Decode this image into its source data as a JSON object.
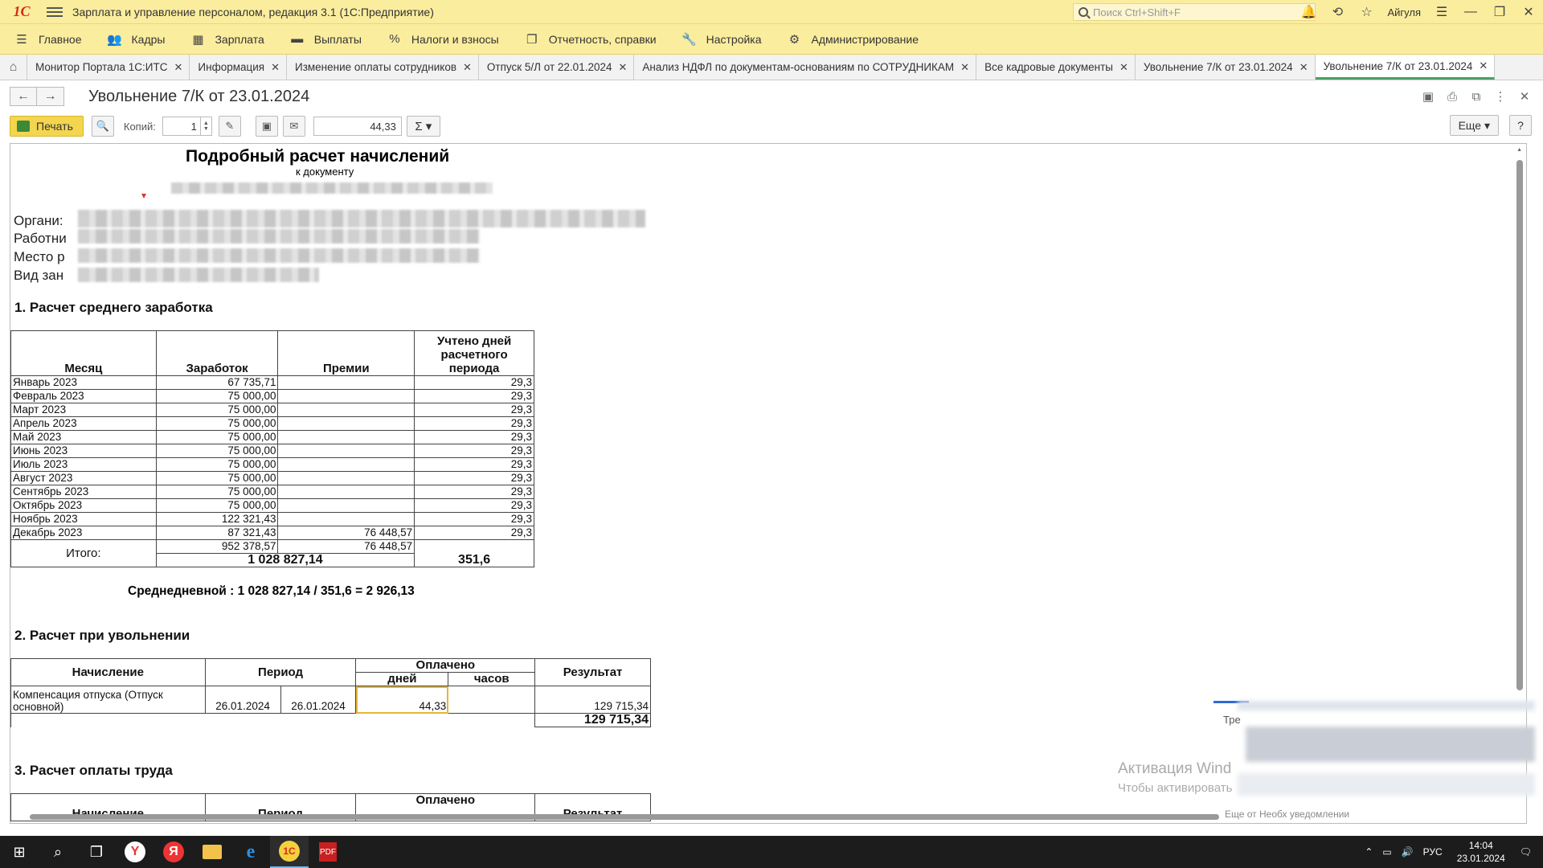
{
  "titlebar": {
    "logo": "1С",
    "title": "Зарплата и управление персоналом, редакция 3.1  (1С:Предприятие)",
    "search_placeholder": "Поиск Ctrl+Shift+F",
    "user": "Айгуля"
  },
  "menu": [
    {
      "label": "Главное",
      "icon": "menu-icon"
    },
    {
      "label": "Кадры",
      "icon": "people-icon"
    },
    {
      "label": "Зарплата",
      "icon": "calculator-icon"
    },
    {
      "label": "Выплаты",
      "icon": "wallet-icon"
    },
    {
      "label": "Налоги и взносы",
      "icon": "percent-icon"
    },
    {
      "label": "Отчетность, справки",
      "icon": "report-icon"
    },
    {
      "label": "Настройка",
      "icon": "wrench-icon"
    },
    {
      "label": "Администрирование",
      "icon": "gear-icon"
    }
  ],
  "tabs": [
    "Монитор Портала 1С:ИТС",
    "Информация",
    "Изменение оплаты сотрудников",
    "Отпуск 5/Л от 22.01.2024",
    "Анализ НДФЛ по документам-основаниям по СОТРУДНИКАМ",
    "Все кадровые документы",
    "Увольнение 7/К от 23.01.2024",
    "Увольнение 7/К от 23.01.2024"
  ],
  "doc": {
    "title": "Увольнение 7/К от 23.01.2024"
  },
  "toolbar": {
    "print_label": "Печать",
    "copies_label": "Копий:",
    "copies_value": "1",
    "sum_value": "44,33",
    "more_label": "Еще",
    "help_label": "?"
  },
  "report": {
    "title": "Подробный расчет начислений",
    "subtitle": "к документу",
    "info_labels": [
      "Органи:",
      "Работни",
      "Место р",
      "Вид зан"
    ],
    "section1": "1. Расчет среднего заработка",
    "t1_headers": [
      "Месяц",
      "Заработок",
      "Премии",
      "Учтено дней расчетного периода"
    ],
    "t1_rows": [
      [
        "Январь 2023",
        "67 735,71",
        "",
        "29,3"
      ],
      [
        "Февраль 2023",
        "75 000,00",
        "",
        "29,3"
      ],
      [
        "Март 2023",
        "75 000,00",
        "",
        "29,3"
      ],
      [
        "Апрель 2023",
        "75 000,00",
        "",
        "29,3"
      ],
      [
        "Май 2023",
        "75 000,00",
        "",
        "29,3"
      ],
      [
        "Июнь 2023",
        "75 000,00",
        "",
        "29,3"
      ],
      [
        "Июль 2023",
        "75 000,00",
        "",
        "29,3"
      ],
      [
        "Август 2023",
        "75 000,00",
        "",
        "29,3"
      ],
      [
        "Сентябрь 2023",
        "75 000,00",
        "",
        "29,3"
      ],
      [
        "Октябрь 2023",
        "75 000,00",
        "",
        "29,3"
      ],
      [
        "Ноябрь 2023",
        "122 321,43",
        "",
        "29,3"
      ],
      [
        "Декабрь 2023",
        "87 321,43",
        "76 448,57",
        "29,3"
      ]
    ],
    "t1_subtotal": [
      "952 378,57",
      "76 448,57"
    ],
    "t1_total_label": "Итого:",
    "t1_total": "1 028 827,14",
    "t1_total_days": "351,6",
    "avg_text": "Среднедневной : 1 028 827,14 / 351,6 =   2 926,13",
    "section2": "2. Расчет при увольнении",
    "t2_headers": {
      "accrual": "Начисление",
      "period": "Период",
      "paid": "Оплачено",
      "days": "дней",
      "hours": "часов",
      "result": "Результат"
    },
    "t2_row": {
      "accrual": "Компенсация отпуска (Отпуск основной)",
      "from": "26.01.2024",
      "to": "26.01.2024",
      "days": "44,33",
      "hours": "",
      "result": "129 715,34"
    },
    "t2_total": "129 715,34",
    "section3": "3. Расчет оплаты труда",
    "t3_headers": {
      "accrual": "Начисление",
      "period": "Период",
      "paid": "Оплачено",
      "result": "Результат"
    }
  },
  "overlay": {
    "activation_title": "Активация Wind",
    "activation_sub": "Чтобы активировать",
    "notif_label": "Тре",
    "notif_footer": "Еще от Необх уведомлении"
  },
  "taskbar": {
    "lang": "РУС",
    "time": "14:04",
    "date": "23.01.2024"
  }
}
